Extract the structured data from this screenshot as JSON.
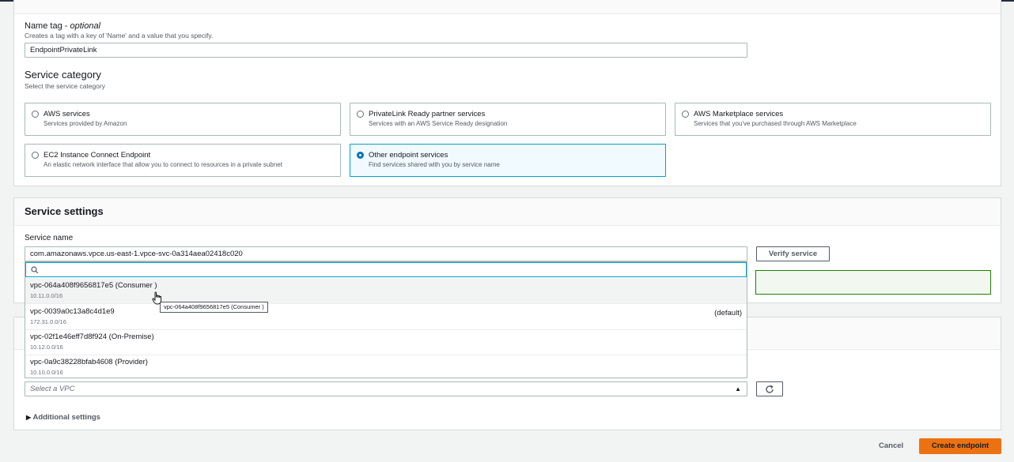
{
  "name_tag": {
    "label": "Name tag - ",
    "label_optional": "optional",
    "description": "Creates a tag with a key of 'Name' and a value that you specify.",
    "value": "EndpointPrivateLink"
  },
  "service_category": {
    "title": "Service category",
    "description": "Select the service category",
    "options": [
      {
        "title": "AWS services",
        "desc": "Services provided by Amazon",
        "selected": false
      },
      {
        "title": "PrivateLink Ready partner services",
        "desc": "Services with an AWS Service Ready designation",
        "selected": false
      },
      {
        "title": "AWS Marketplace services",
        "desc": "Services that you've purchased through AWS Marketplace",
        "selected": false
      },
      {
        "title": "EC2 Instance Connect Endpoint",
        "desc": "An elastic network interface that allow you to connect to resources in a private subnet",
        "selected": false
      },
      {
        "title": "Other endpoint services",
        "desc": "Find services shared with you by service name",
        "selected": true
      }
    ]
  },
  "service_settings": {
    "title": "Service settings",
    "service_name_label": "Service name",
    "service_name_value": "com.amazonaws.vpce.us-east-1.vpce-svc-0a314aea02418c020",
    "verify_button": "Verify service"
  },
  "vpc_dropdown": {
    "search_placeholder": "",
    "items": [
      {
        "name": "vpc-064a408f9656817e5 (Consumer )",
        "cidr": "10.11.0.0/16",
        "tag": ""
      },
      {
        "name": "vpc-0039a0c13a8c4d1e9",
        "cidr": "172.31.0.0/16",
        "tag": "(default)"
      },
      {
        "name": "vpc-02f1e46eff7d8f924 (On-Premise)",
        "cidr": "10.12.0.0/16",
        "tag": ""
      },
      {
        "name": "vpc-0a9c38228bfab4608 (Provider)",
        "cidr": "10.10.0.0/16",
        "tag": ""
      }
    ],
    "tooltip": "vpc-064a408f9656817e5 (Consumer )",
    "select_placeholder": "Select a VPC"
  },
  "additional_settings": "Additional settings",
  "footer": {
    "cancel": "Cancel",
    "create": "Create endpoint"
  },
  "colors": {
    "accent": "#0073bb",
    "primary_button": "#ec7211",
    "success_border": "#1d8102"
  }
}
